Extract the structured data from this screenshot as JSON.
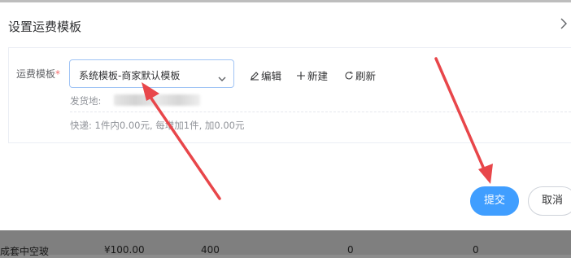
{
  "dialog": {
    "title": "设置运费模板",
    "close_icon": "chevron-right-icon"
  },
  "form": {
    "template_label": "运费模板",
    "required_mark": "*",
    "template_select_value": "系统模板-商家默认模板",
    "actions": {
      "edit": "编辑",
      "new": "新建",
      "refresh": "刷新"
    },
    "ship_from_label": "发货地:",
    "shipping_rule": "快递: 1件内0.00元, 每增加1件, 加0.00元"
  },
  "buttons": {
    "submit": "提交",
    "cancel": "取消"
  },
  "background_row": {
    "product_name": "成套中空玻",
    "price": "¥100.00",
    "stock": "400",
    "col4": "0",
    "col5": "0"
  },
  "annotation_color": "#e8464a",
  "accent_color": "#409eff"
}
